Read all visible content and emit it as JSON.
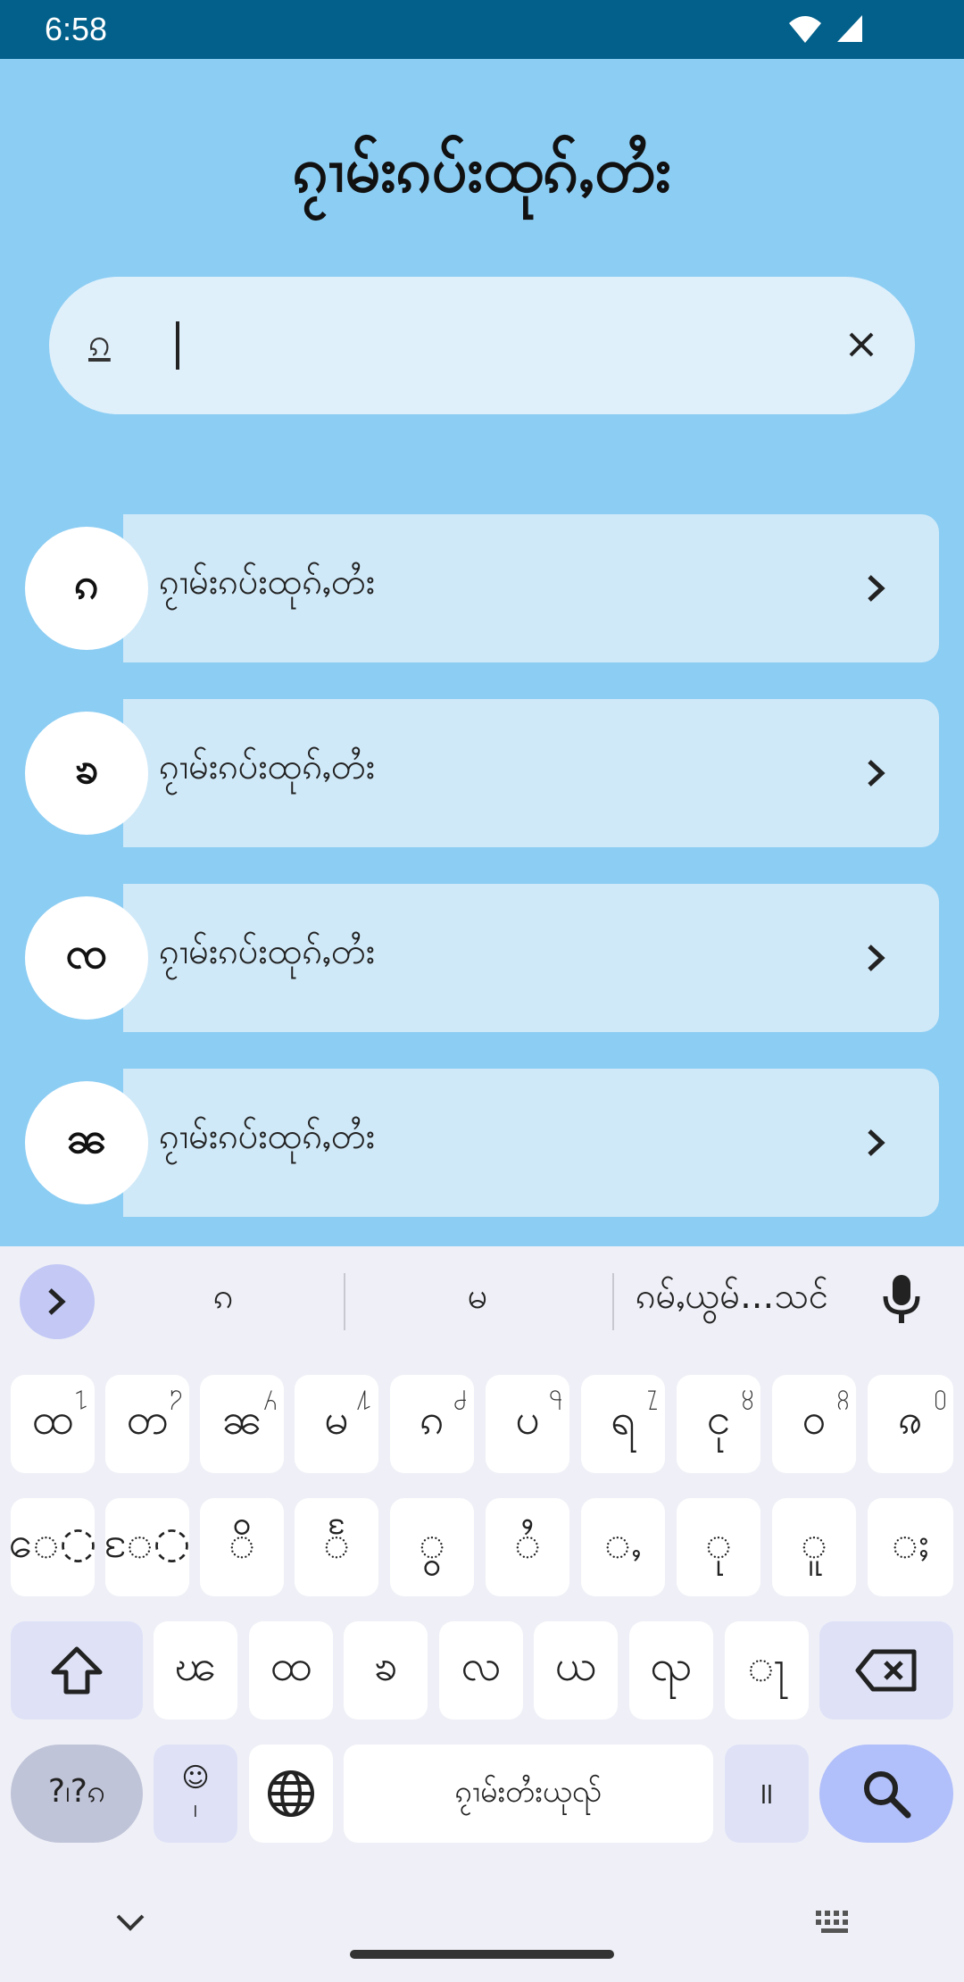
{
  "status_bar": {
    "time": "6:58",
    "icons": [
      "wifi-icon",
      "signal-icon"
    ]
  },
  "app": {
    "title": "ၵႂၢမ်းၵပ်းထုၵ်ႇတႆး",
    "search": {
      "value": "ၵ",
      "clear_icon": "close-icon"
    },
    "items": [
      {
        "badge": "ၵ",
        "label": "ၵႂၢမ်းၵပ်းထုၵ်ႇတႆး"
      },
      {
        "badge": "ၶ",
        "label": "ၵႂၢမ်းၵပ်းထုၵ်ႇတႆး"
      },
      {
        "badge": "ၸ",
        "label": "ၵႂၢမ်းၵပ်းထုၵ်ႇတႆး"
      },
      {
        "badge": "ၼ",
        "label": "ၵႂၢမ်းၵပ်းထုၵ်ႇတႆး"
      }
    ]
  },
  "keyboard": {
    "suggestions": [
      "ၵ",
      "မ",
      "ၵမ်ႇယွမ်...သင်"
    ],
    "row1": [
      {
        "label": "ထ",
        "hint": "႑"
      },
      {
        "label": "တ",
        "hint": "႒"
      },
      {
        "label": "ၼ",
        "hint": "႓"
      },
      {
        "label": "မ",
        "hint": "႔"
      },
      {
        "label": "ၵ",
        "hint": "႕"
      },
      {
        "label": "ပ",
        "hint": "႖"
      },
      {
        "label": "ရ",
        "hint": "႗"
      },
      {
        "label": "ငု",
        "hint": "႘"
      },
      {
        "label": "ဝ",
        "hint": "႙"
      },
      {
        "label": "ၷ",
        "hint": "႐"
      }
    ],
    "row2": [
      "ေ◌",
      "ႄ◌",
      "◌ိ",
      "◌ႅ",
      "◌ွ",
      "◌ႆ",
      "◌ႇ",
      "◌ု",
      "◌ူ",
      "◌ႈ"
    ],
    "row3": [
      "ၽ",
      "ထ",
      "ၶ",
      "လ",
      "ယ",
      "ၺ",
      "◌ႃ"
    ],
    "symbols_label": "?၊?ၵ",
    "emoji_label": "☺\n၊",
    "space_label": "ၵႂၢမ်းတႆးယုၺ်",
    "period_label": "။",
    "colors": {
      "accent": "#b1bffa",
      "mod": "#dfe2f7",
      "bg": "#eff0f7"
    }
  }
}
